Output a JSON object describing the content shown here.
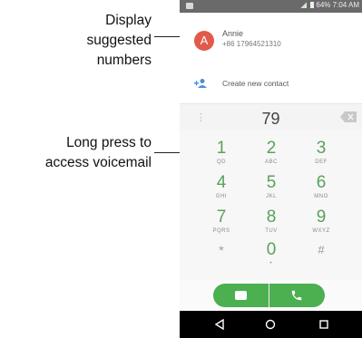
{
  "annotations": {
    "suggested_line1": "Display",
    "suggested_line2": "suggested",
    "suggested_line3": "numbers",
    "voicemail_line1": "Long press to",
    "voicemail_line2": "access voicemail"
  },
  "status_bar": {
    "right_text": "64% 7:04 AM",
    "icons": [
      "notification-icon",
      "signal-icon",
      "battery-icon"
    ]
  },
  "suggestion": {
    "avatar_letter": "A",
    "avatar_color": "#e15a4a",
    "name": "Annie",
    "number": "+86 17964521310",
    "create_contact_label": "Create new contact"
  },
  "dialer": {
    "digits": "79",
    "menu_icon": "more-vert-icon",
    "backspace_icon": "backspace-icon"
  },
  "keypad": {
    "keys": [
      {
        "num": "1",
        "letters": "QD"
      },
      {
        "num": "2",
        "letters": "ABC"
      },
      {
        "num": "3",
        "letters": "DEF"
      },
      {
        "num": "4",
        "letters": "GHI"
      },
      {
        "num": "5",
        "letters": "JKL"
      },
      {
        "num": "6",
        "letters": "MNO"
      },
      {
        "num": "7",
        "letters": "PQRS"
      },
      {
        "num": "8",
        "letters": "TUV"
      },
      {
        "num": "9",
        "letters": "WXYZ"
      },
      {
        "num": "*",
        "letters": ""
      },
      {
        "num": "0",
        "letters": "+"
      },
      {
        "num": "#",
        "letters": ""
      }
    ]
  },
  "colors": {
    "accent_green": "#4caf50",
    "key_green": "#5aa15c"
  },
  "navigation": {
    "icons": [
      "back-icon",
      "home-icon",
      "recents-icon"
    ]
  }
}
